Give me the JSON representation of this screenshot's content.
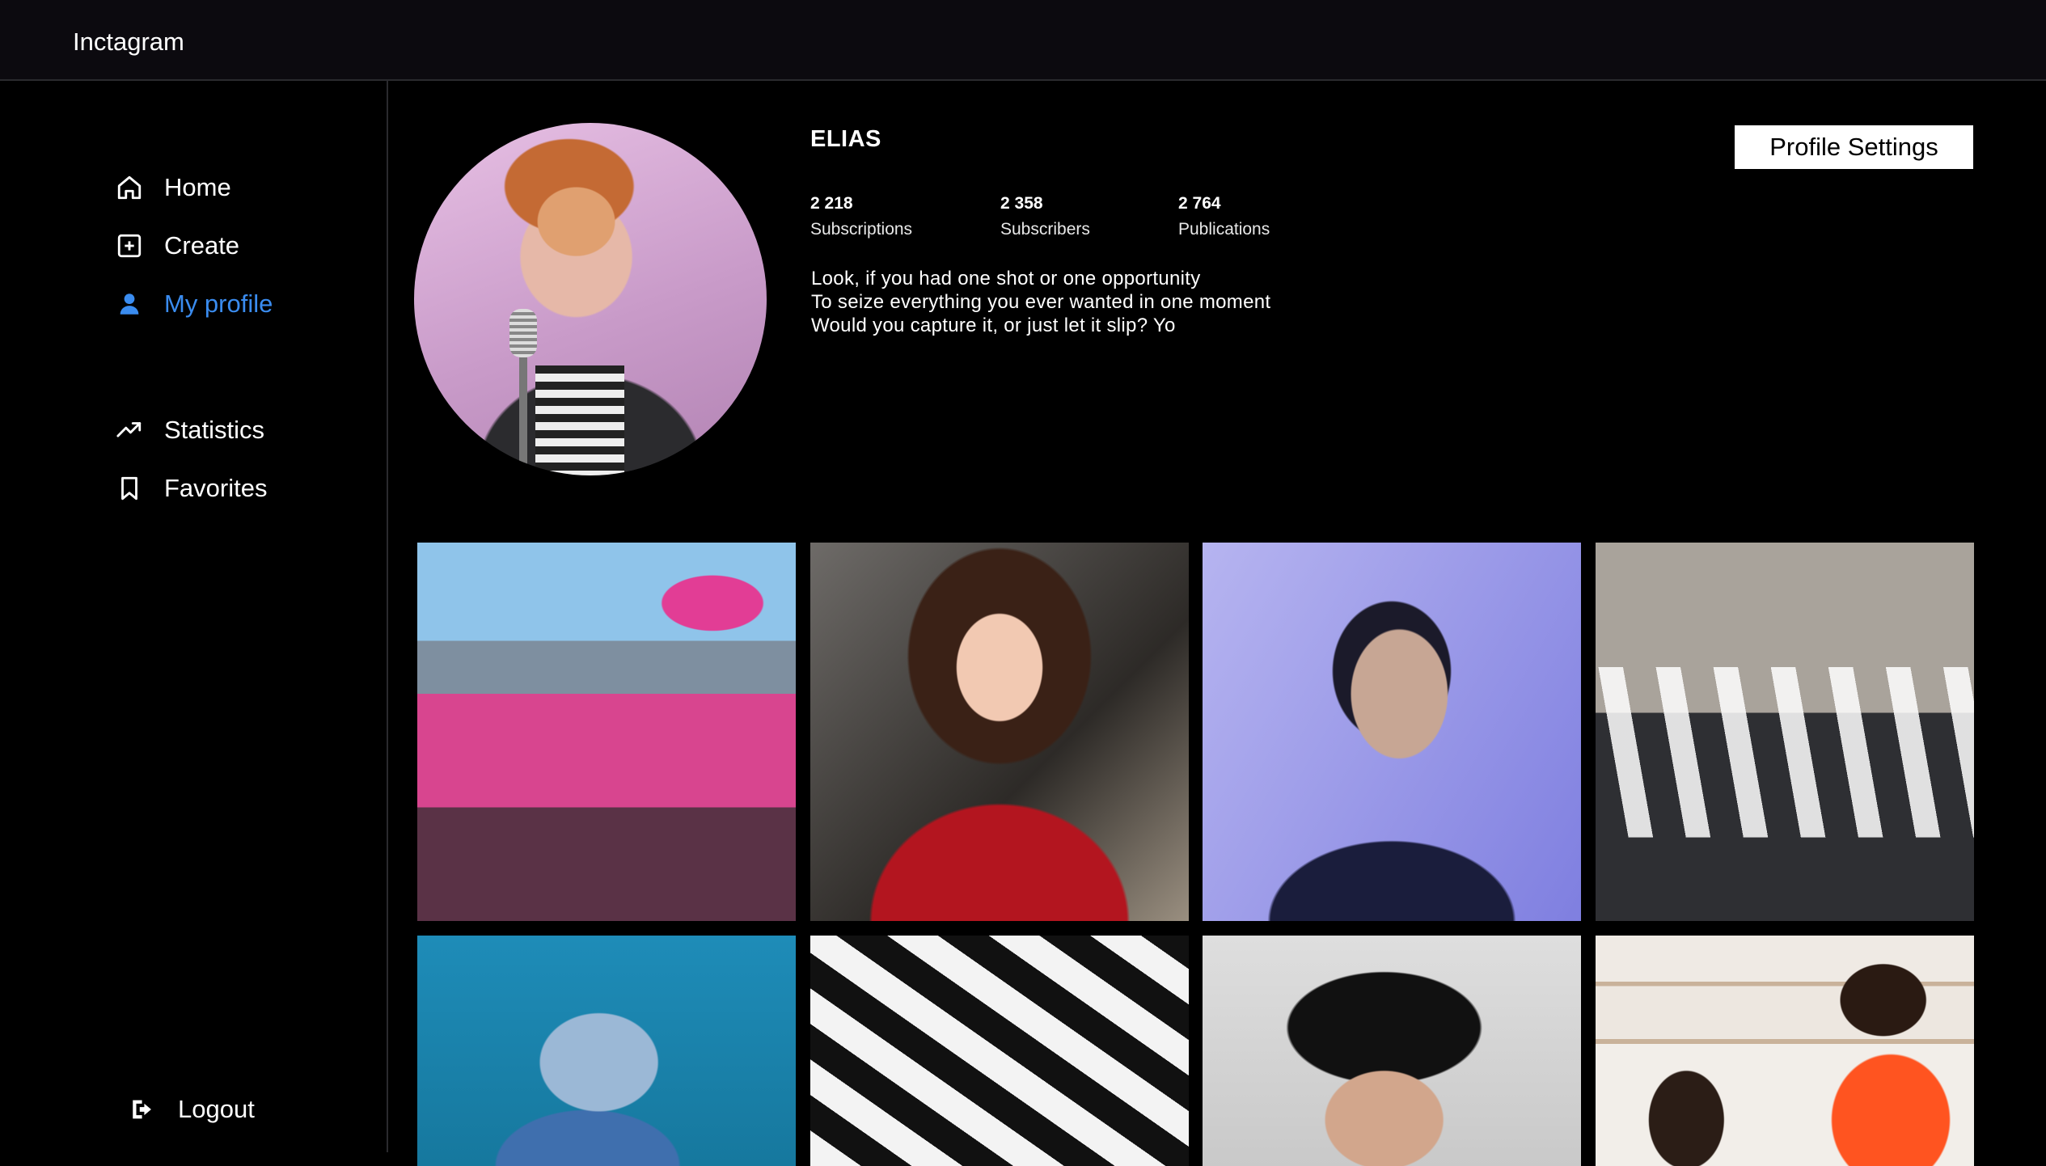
{
  "app": {
    "title": "Inctagram"
  },
  "sidebar": {
    "items": [
      {
        "label": "Home",
        "icon": "home-icon",
        "active": false
      },
      {
        "label": "Create",
        "icon": "plus-square-icon",
        "active": false
      },
      {
        "label": "My profile",
        "icon": "person-icon",
        "active": true
      },
      {
        "label": "Statistics",
        "icon": "trending-up-icon",
        "active": false
      },
      {
        "label": "Favorites",
        "icon": "bookmark-icon",
        "active": false
      }
    ],
    "logout_label": "Logout"
  },
  "profile": {
    "username": "ELIAS",
    "stats": [
      {
        "value": "2 218",
        "label": "Subscriptions"
      },
      {
        "value": "2 358",
        "label": "Subscribers"
      },
      {
        "value": "2 764",
        "label": "Publications"
      }
    ],
    "bio": "Look, if you had one shot or one opportunity\nTo seize everything you ever wanted in one moment\nWould you capture it, or just let it slip? Yo",
    "settings_label": "Profile Settings"
  },
  "colors": {
    "accent": "#3a8cf0",
    "background": "#000000",
    "header": "#0c0a0f",
    "divider": "#2a2a2e"
  }
}
